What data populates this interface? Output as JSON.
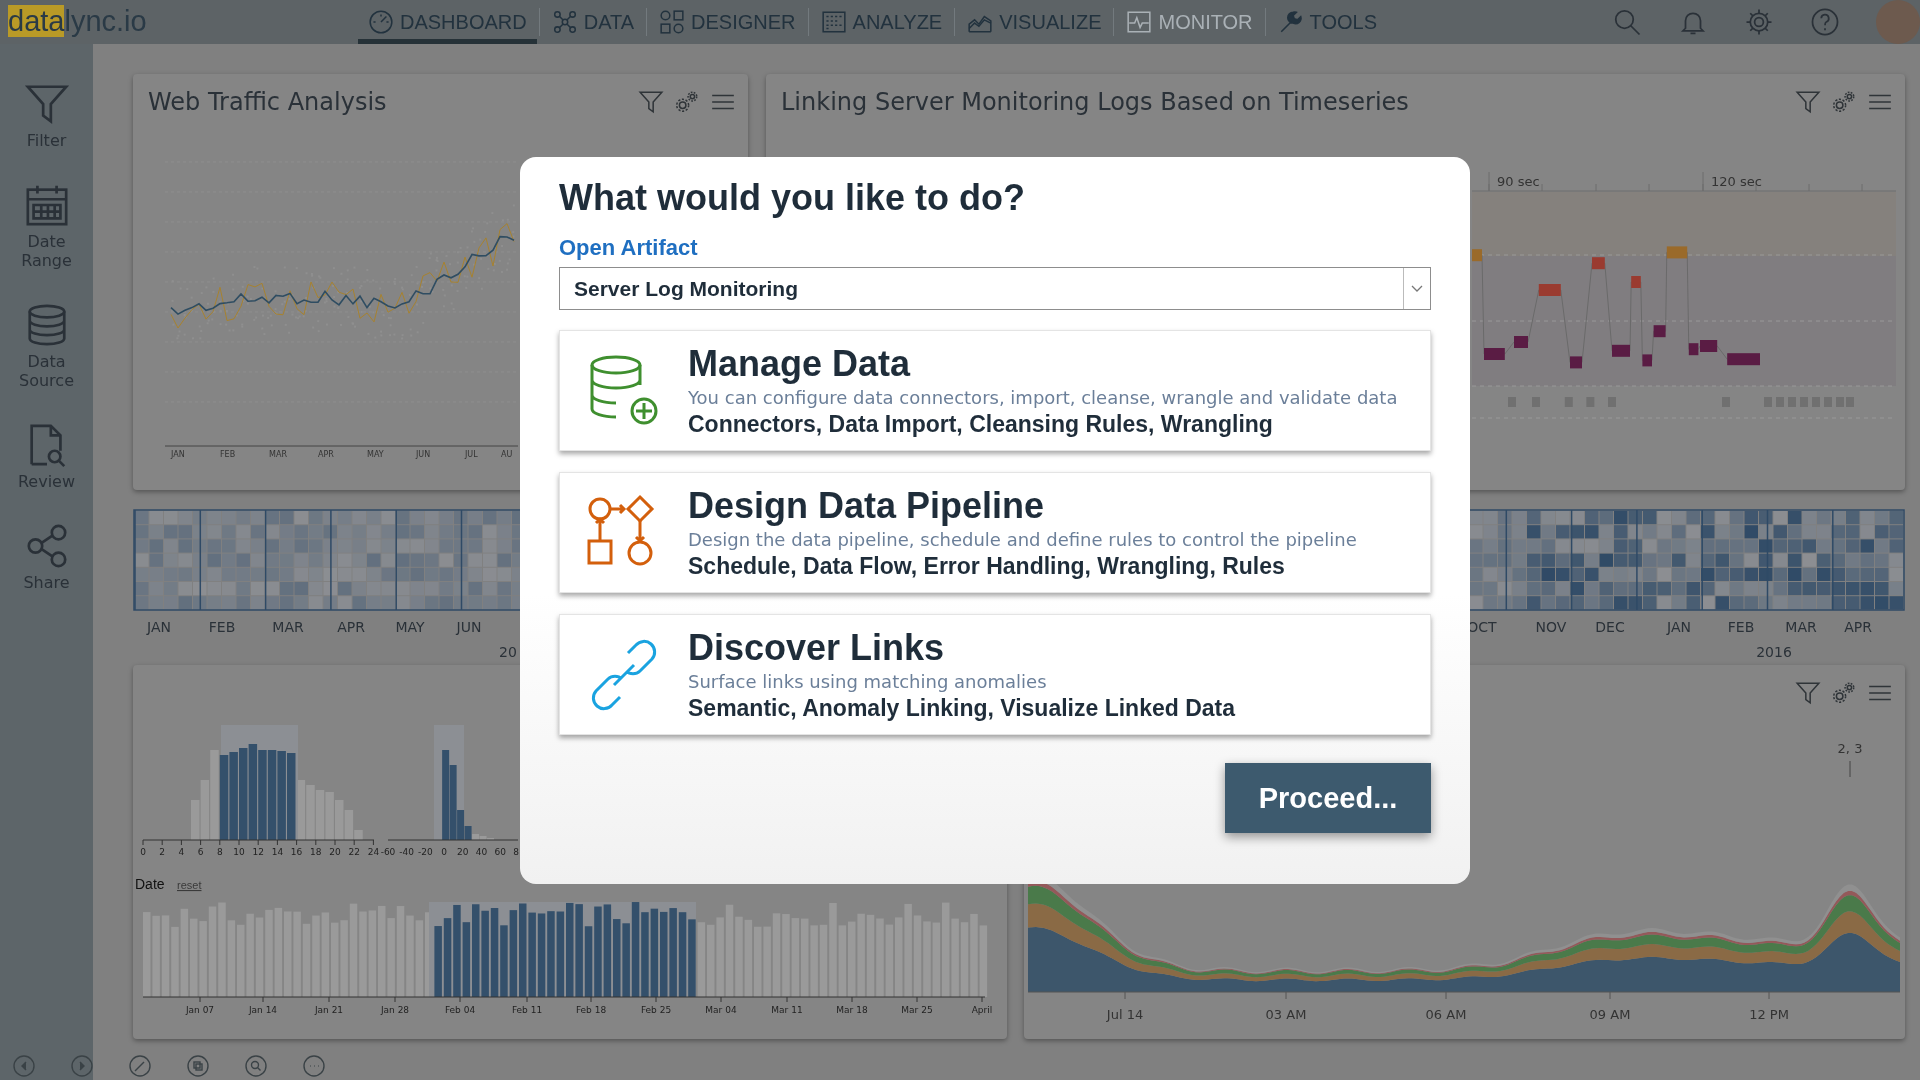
{
  "logo": {
    "highlight": "data",
    "rest": "lync.io"
  },
  "nav": [
    {
      "label": "DASHBOARD",
      "selected": true,
      "disabled": false
    },
    {
      "label": "DATA",
      "selected": false,
      "disabled": false
    },
    {
      "label": "DESIGNER",
      "selected": false,
      "disabled": false
    },
    {
      "label": "ANALYZE",
      "selected": false,
      "disabled": false
    },
    {
      "label": "VISUALIZE",
      "selected": false,
      "disabled": false
    },
    {
      "label": "MONITOR",
      "selected": false,
      "disabled": true
    },
    {
      "label": "TOOLS",
      "selected": false,
      "disabled": false
    }
  ],
  "sidebar": [
    {
      "label": "Filter"
    },
    {
      "label": "Date Range"
    },
    {
      "label": "Data Source"
    },
    {
      "label": "Review"
    },
    {
      "label": "Share"
    }
  ],
  "web_traffic": {
    "title": "Web Traffic Analysis",
    "months": [
      "JAN",
      "FEB",
      "MAR",
      "APR",
      "MAY",
      "JUN",
      "JUL",
      "AU"
    ]
  },
  "server_logs": {
    "title": "Linking Server Monitoring Logs Based on Timeseries",
    "ticks": [
      "90 sec",
      "120 sec"
    ]
  },
  "calendar": {
    "left_months": [
      "JAN",
      "FEB",
      "MAR",
      "APR",
      "MAY",
      "JUN"
    ],
    "left_year": "20",
    "right_months": [
      "OCT",
      "NOV",
      "DEC",
      "JAN",
      "FEB",
      "MAR",
      "APR"
    ],
    "right_year": "2016"
  },
  "histograms": {
    "hour_ticks": [
      "0",
      "2",
      "4",
      "6",
      "8",
      "10",
      "12",
      "14",
      "16",
      "18",
      "20",
      "22",
      "24"
    ],
    "offset_ticks": [
      "-60",
      "-40",
      "-20",
      "0",
      "20",
      "40",
      "60",
      "8"
    ],
    "date_label": "Date",
    "reset": "reset",
    "date_ticks": [
      "Jan 07",
      "Jan 14",
      "Jan 21",
      "Jan 28",
      "Feb 04",
      "Feb 11",
      "Feb 18",
      "Feb 25",
      "Mar 04",
      "Mar 11",
      "Mar 18",
      "Mar 25",
      "April"
    ]
  },
  "stream": {
    "ticks": [
      "Jul 14",
      "03 AM",
      "06 AM",
      "09 AM",
      "12 PM"
    ],
    "annotation": "2, 3"
  },
  "dialog": {
    "title": "What would you like to do?",
    "artifact_label": "Open Artifact",
    "artifact_value": "Server Log Monitoring",
    "options": [
      {
        "kind": "database",
        "color": "#3f8f2f",
        "title": "Manage Data",
        "description": "You can configure data connectors, import, cleanse, wrangle and validate data",
        "keywords": "Connectors, Data Import, Cleansing Rules, Wrangling"
      },
      {
        "kind": "pipeline",
        "color": "#d35f0c",
        "title": "Design Data Pipeline",
        "description": "Design the data pipeline, schedule and define rules to control the pipeline",
        "keywords": "Schedule, Data Flow, Error Handling, Wrangling, Rules"
      },
      {
        "kind": "link",
        "color": "#1aa3e0",
        "title": "Discover Links",
        "description": "Surface links using matching anomalies",
        "keywords": "Semantic, Anomaly Linking, Visualize Linked Data"
      }
    ],
    "button": "Proceed..."
  }
}
